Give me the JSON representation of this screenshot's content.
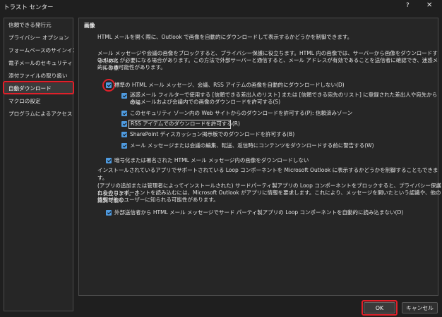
{
  "window": {
    "title": "トラスト センター",
    "help_glyph": "?",
    "close_glyph": "✕"
  },
  "sidebar": {
    "items": [
      {
        "label": "信頼できる発行元"
      },
      {
        "label": "プライバシー オプション"
      },
      {
        "label": "フォームベースのサインイン"
      },
      {
        "label": "電子メールのセキュリティ"
      },
      {
        "label": "添付ファイルの取り扱い"
      },
      {
        "label": "自動ダウンロード",
        "selected": true
      },
      {
        "label": "マクロの設定"
      },
      {
        "label": "プログラムによるアクセス"
      }
    ]
  },
  "main": {
    "section_title": "画像",
    "intro": "HTML メールを開く際に、Outlook で画像を自動的にダウンロードして表示するかどうかを制御できます。",
    "desc_line1": "メール メッセージや会議の画像をブロックすると、プライバシー保護に役立ちます。HTML 内の画像では、サーバーから画像をダウンロードするために",
    "desc_line2": "Outlook が必要になる場合があります。この方法で外部サーバーと通信すると、メール アドレスが有効であることを送信者に確認でき、迷惑メールの標",
    "desc_line3": "的になる可能性があります。",
    "opt_main": "標準の HTML メール メッセージ、会議、RSS アイテムの画像を自動的にダウンロードしない(D)",
    "opt_sub1_line1": "迷惑メール フィルターで使用する [信頼できる差出人のリスト] または [信頼できる宛先のリスト] に登録された差出人や宛先からの場",
    "opt_sub1_line2": "合にメールおよび会議内での画像のダウンロードを許可する(S)",
    "opt_sub2": "このセキュリティ ゾーン内の Web サイトからのダウンロードを許可する(P): 信頼済みゾーン",
    "opt_sub3": "RSS アイテムでのダウンロードを許可する(R)",
    "opt_sub4": "SharePoint ディスカッション掲示板でのダウンロードを許可する(B)",
    "opt_sub5": "メール メッセージまたは会議の編集、転送、返信時にコンテンツをダウンロードする前に警告する(W)",
    "opt_encrypted": "暗号化または署名された HTML メール メッセージ内の画像をダウンロードしない",
    "loop_intro": "インストールされているアプリでサポートされている Loop コンポーネントを Microsoft Outlook に表示するかどうかを制御することもできます。",
    "loop_desc_line1": "(アプリの追加または管理者によってインストールされた) サードパーティ製アプリの Loop コンポーネントをブロックすると、プライバシー保護に役立ちます。こ",
    "loop_desc_line2": "れらのコンポーネントを読み込むには、Microsoft Outlook がアプリに情報を要求します。これにより、メッセージを開いたという認識や、他の識別可能な",
    "loop_desc_line3": "情報が他のユーザーに知られる可能性があります。",
    "opt_loop": "外部送信者から HTML メール メッセージでサード パーティ製アプリの Loop コンポーネントを自動的に読み込まない(D)"
  },
  "footer": {
    "ok_label": "OK",
    "cancel_label": "キャンセル"
  },
  "colors": {
    "accent": "#4f9be0",
    "highlight": "#e0202a",
    "background": "#1f1f1f"
  }
}
